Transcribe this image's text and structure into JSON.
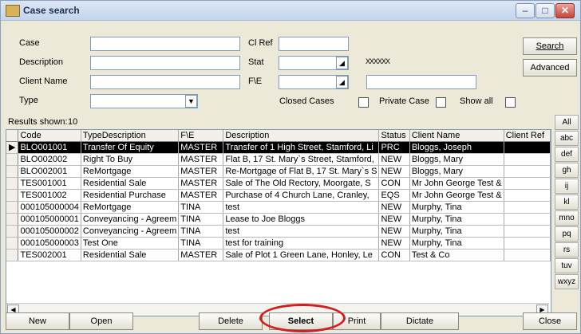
{
  "window": {
    "title": "Case search"
  },
  "form": {
    "case_label": "Case",
    "description_label": "Description",
    "client_name_label": "Client Name",
    "type_label": "Type",
    "clref_label": "Cl Ref",
    "stat_label": "Stat",
    "fe_label": "F\\E",
    "xxx_text": "XXXXXX",
    "closed_cases_label": "Closed Cases",
    "private_case_label": "Private Case",
    "show_all_label": "Show all"
  },
  "buttons": {
    "search": "Search",
    "advanced": "Advanced",
    "new": "New",
    "open": "Open",
    "delete": "Delete",
    "select": "Select",
    "print": "Print",
    "dictate": "Dictate",
    "close": "Close"
  },
  "results": {
    "label": "Results shown:",
    "count": "10"
  },
  "table": {
    "headers": [
      "Code",
      "TypeDescription",
      "F\\E",
      "Description",
      "Status",
      "Client Name",
      "Client Ref"
    ],
    "rows": [
      [
        "BLO001001",
        "Transfer Of Equity",
        "MASTER",
        "Transfer of 1 High Street, Stamford, Li",
        "PRC",
        "Bloggs, Joseph",
        ""
      ],
      [
        "BLO002002",
        "Right To Buy",
        "MASTER",
        "Flat B, 17 St. Mary`s Street, Stamford,",
        "NEW",
        "Bloggs, Mary",
        ""
      ],
      [
        "BLO002001",
        "ReMortgage",
        "MASTER",
        "Re-Mortgage of Flat B, 17 St. Mary`s S",
        "NEW",
        "Bloggs, Mary",
        ""
      ],
      [
        "TES001001",
        "Residential Sale",
        "MASTER",
        "Sale of The Old Rectory, Moorgate, S",
        "CON",
        "Mr John George Test &",
        ""
      ],
      [
        "TES001002",
        "Residential Purchase",
        "MASTER",
        "Purchase of 4 Church Lane, Cranley,",
        "EQS",
        "Mr John George Test &",
        ""
      ],
      [
        "000105000004",
        "ReMortgage",
        "TINA",
        "test",
        "NEW",
        "Murphy, Tina",
        ""
      ],
      [
        "000105000001",
        "Conveyancing - Agreem",
        "TINA",
        "Lease to Joe Bloggs",
        "NEW",
        "Murphy, Tina",
        ""
      ],
      [
        "000105000002",
        "Conveyancing - Agreem",
        "TINA",
        "test",
        "NEW",
        "Murphy, Tina",
        ""
      ],
      [
        "000105000003",
        "Test One",
        "TINA",
        "test for training",
        "NEW",
        "Murphy, Tina",
        ""
      ],
      [
        "TES002001",
        "Residential Sale",
        "MASTER",
        "Sale of Plot 1 Green Lane, Honley, Le",
        "CON",
        "Test & Co",
        ""
      ]
    ]
  },
  "alpha_tabs": [
    "All",
    "abc",
    "def",
    "gh",
    "ij",
    "kl",
    "mno",
    "pq",
    "rs",
    "tuv",
    "wxyz"
  ],
  "icons": {
    "minimize": "minimize-icon",
    "maximize": "maximize-icon",
    "close": "close-icon",
    "combo": "dropdown-arrow-icon",
    "scroll_left": "arrow-left-icon",
    "scroll_right": "arrow-right-icon",
    "row_pointer": "row-pointer-icon"
  },
  "colors": {
    "highlight_circle": "#d01f1f",
    "selected_row": "#000000"
  }
}
